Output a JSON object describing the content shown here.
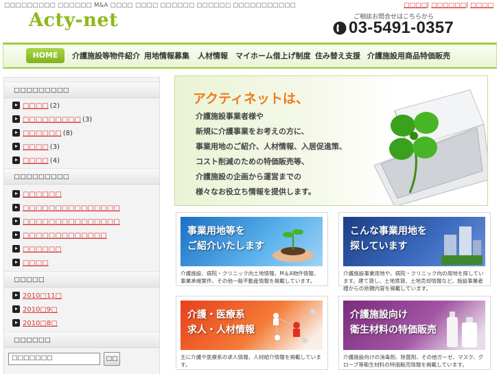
{
  "header": {
    "tagline": "□□□□□□□□□ □□□□□□ M&A □□□□ □□□□ □□□□□□ □□□□□□ □□□□□□□□□□□",
    "top_links": [
      "□□□□",
      "□□□□□□",
      "□□□□"
    ],
    "logo": "Acty-net",
    "contact_label": "ご相談お問合せはこちらから",
    "phone": "03-5491-0357",
    "phone_icon": "phone-icon"
  },
  "nav": {
    "home": "HOME",
    "items": [
      "介護施設等物件紹介",
      "用地情報募集",
      "人材情報",
      "マイホーム借上げ制度",
      "住み替え支援",
      "介護施設用商品特価販売"
    ]
  },
  "sidebar": {
    "categories_heading": "□□□□□□□□□",
    "categories": [
      {
        "label": "□□□□",
        "count": "(2)"
      },
      {
        "label": "□□□□□□□□□",
        "count": "(3)"
      },
      {
        "label": "□□□□□□",
        "count": "(8)"
      },
      {
        "label": "□□□□",
        "count": "(3)"
      },
      {
        "label": "□□□□",
        "count": "(4)"
      }
    ],
    "recent_heading": "□□□□□□□□□",
    "recent": [
      "□□□□□□",
      "□□□□□□□□□□□□□□□",
      "□□□□□□□□□□□□□□□",
      "□□□□□□□□□□□□□",
      "□□□□□□",
      "□□□□"
    ],
    "archive_heading": "□□□□□",
    "archives": [
      {
        "year": "2010",
        "month": "11"
      },
      {
        "year": "2010",
        "month": "9"
      },
      {
        "year": "2010",
        "month": "8"
      }
    ],
    "search_heading": "□□□□□□",
    "search_value": "□□□□□□□",
    "search_button": "□□"
  },
  "hero": {
    "title": "アクティネットは、",
    "lines": [
      "介護施設事業者様や",
      "新規に介護事業をお考えの方に、",
      "事業用地のご紹介、人材情報、入居促進策、",
      "コスト削減のための特価販売等、",
      "介護施設の企画から運営までの",
      "様々なお役立ち情報を提供します。"
    ]
  },
  "cards": [
    {
      "banner": [
        "事業用地等を",
        "ご紹介いたします"
      ],
      "desc": "介護施設、病院・クリニック向土地情報、M＆A物件情報、事業承継案件、その他一般不動産情報を掲載しています。"
    },
    {
      "banner": [
        "こんな事業用地を",
        "探しています"
      ],
      "desc": "介護施設事業用地や、病院・クリニック向の用地を探しています。建て貸し、土地賃貸、土地売却情報など、施設事業者様からの依頼内容を掲載しています。"
    },
    {
      "banner": [
        "介護・医療系",
        "求人・人材情報"
      ],
      "desc": "主に介護や医療系の求人情報、人材紹介情報を掲載しています。"
    },
    {
      "banner": [
        "介護施設向け",
        "衛生材料の特価販売"
      ],
      "desc": "介護施設向けの消毒剤、除菌剤、その他ガーゼ、マスク、グローブ等衛生材料の特価販売情報を掲載しています。"
    }
  ],
  "colors": {
    "accent_green": "#9ccb3b",
    "link_red": "#dd3333",
    "hero_orange": "#f07a1a"
  }
}
